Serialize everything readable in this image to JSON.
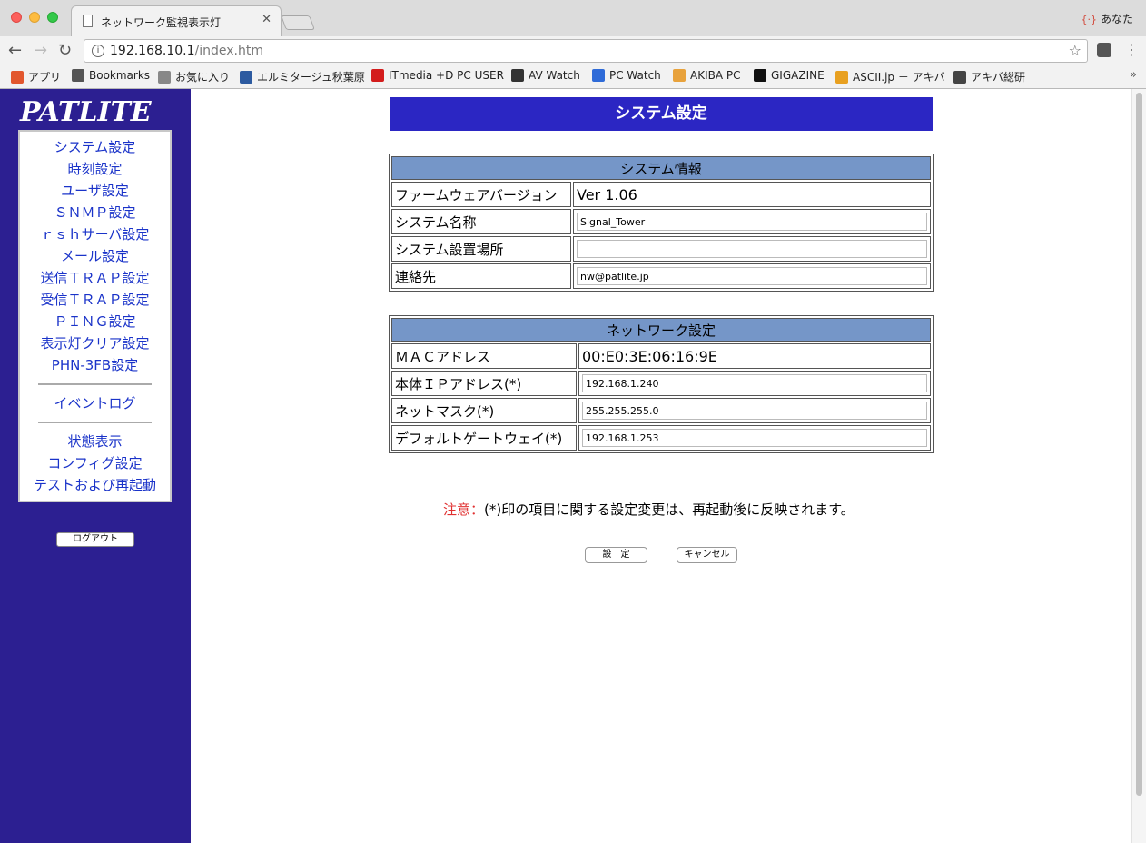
{
  "browser": {
    "tab_title": "ネットワーク監視表示灯",
    "tab_close": "✕",
    "profile_label": "あなた",
    "url_host": "192.168.10.1",
    "url_path": "/index.htm",
    "bookmarks": [
      {
        "label": "アプリ",
        "color": "#e2572e"
      },
      {
        "label": "Bookmarks",
        "color": "#555555"
      },
      {
        "label": "お気に入り",
        "color": "#888888"
      },
      {
        "label": "エルミタージュ秋葉原",
        "color": "#2c5aa0"
      },
      {
        "label": "ITmedia +D PC USER",
        "color": "#d31c1c"
      },
      {
        "label": "AV Watch",
        "color": "#333333"
      },
      {
        "label": "PC Watch",
        "color": "#2f6bd8"
      },
      {
        "label": "AKIBA PC",
        "color": "#e8a23c"
      },
      {
        "label": "GIGAZINE",
        "color": "#111111"
      },
      {
        "label": "ASCII.jp － アキバ",
        "color": "#e8a020"
      },
      {
        "label": "アキバ総研",
        "color": "#444444"
      }
    ],
    "more": "»"
  },
  "sidebar": {
    "logo": "PATLITE",
    "menu_group1": [
      "システム設定",
      "時刻設定",
      "ユーザ設定",
      "ＳＮＭＰ設定",
      "ｒｓｈサーバ設定",
      "メール設定",
      "送信ＴＲＡＰ設定",
      "受信ＴＲＡＰ設定",
      "ＰＩＮＧ設定",
      "表示灯クリア設定",
      "PHN-3FB設定"
    ],
    "menu_group2": [
      "イベントログ"
    ],
    "menu_group3": [
      "状態表示",
      "コンフィグ設定",
      "テストおよび再起動"
    ],
    "logout": "ログアウト"
  },
  "main": {
    "title": "システム設定",
    "system_info": {
      "header": "システム情報",
      "firmware_label": "ファームウェアバージョン",
      "firmware_value": "Ver 1.06",
      "name_label": "システム名称",
      "name_value": "Signal_Tower",
      "location_label": "システム設置場所",
      "location_value": "",
      "contact_label": "連絡先",
      "contact_value": "nw@patlite.jp"
    },
    "network": {
      "header": "ネットワーク設定",
      "mac_label": "ＭＡＣアドレス",
      "mac_value": "00:E0:3E:06:16:9E",
      "ip_label": "本体ＩＰアドレス(*)",
      "ip_value": "192.168.1.240",
      "mask_label": "ネットマスク(*)",
      "mask_value": "255.255.255.0",
      "gw_label": "デフォルトゲートウェイ(*)",
      "gw_value": "192.168.1.253"
    },
    "note_prefix": "注意：",
    "note_text": "(*)印の項目に関する設定変更は、再起動後に反映されます。",
    "set_button": "設　定",
    "cancel_button": "キャンセル"
  }
}
